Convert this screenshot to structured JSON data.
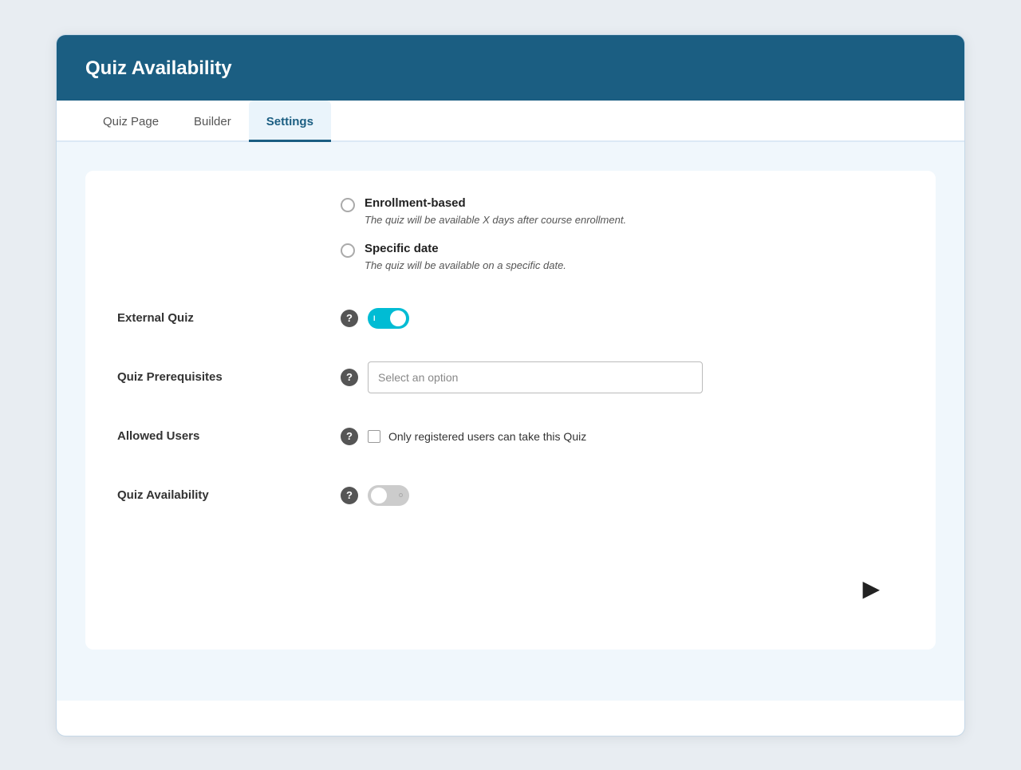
{
  "header": {
    "title": "Quiz Availability"
  },
  "tabs": [
    {
      "id": "quiz-page",
      "label": "Quiz Page",
      "active": false
    },
    {
      "id": "builder",
      "label": "Builder",
      "active": false
    },
    {
      "id": "settings",
      "label": "Settings",
      "active": true
    }
  ],
  "availability_options": [
    {
      "id": "enrollment-based",
      "label": "Enrollment-based",
      "description": "The quiz will be available X days after course enrollment."
    },
    {
      "id": "specific-date",
      "label": "Specific date",
      "description": "The quiz will be available on a specific date."
    }
  ],
  "settings": [
    {
      "id": "external-quiz",
      "label": "External Quiz",
      "type": "toggle-on",
      "toggle_label": "I"
    },
    {
      "id": "quiz-prerequisites",
      "label": "Quiz Prerequisites",
      "type": "select",
      "placeholder": "Select an option"
    },
    {
      "id": "allowed-users",
      "label": "Allowed Users",
      "type": "checkbox",
      "checkbox_label": "Only registered users can take this Quiz"
    },
    {
      "id": "quiz-availability",
      "label": "Quiz Availability",
      "type": "toggle-off"
    }
  ],
  "help_icon_label": "?",
  "colors": {
    "header_bg": "#1b5e82",
    "toggle_on_bg": "#00bcd4",
    "toggle_off_bg": "#cccccc"
  }
}
